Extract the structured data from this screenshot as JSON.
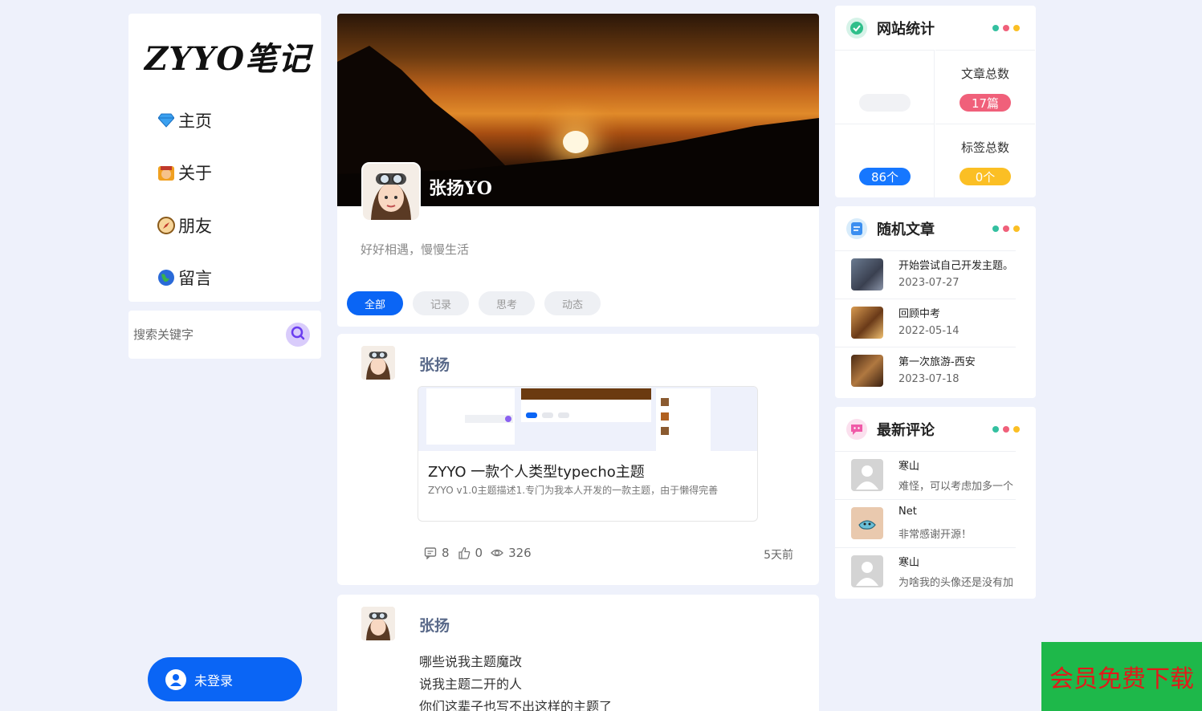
{
  "sidebar": {
    "logo": "ZYYO笔记",
    "nav": [
      {
        "label": "主页",
        "icon": "diamond-icon"
      },
      {
        "label": "关于",
        "icon": "king-icon"
      },
      {
        "label": "朋友",
        "icon": "compass-icon"
      },
      {
        "label": "留言",
        "icon": "globe-icon"
      }
    ],
    "search_placeholder": "搜索关键字",
    "login_label": "未登录"
  },
  "profile": {
    "name": "张扬YO",
    "bio": "好好相遇，慢慢生活",
    "tabs": [
      "全部",
      "记录",
      "思考",
      "动态"
    ],
    "active_tab": "全部"
  },
  "posts": [
    {
      "author": "张扬",
      "link_title": "ZYYO 一款个人类型typecho主题",
      "link_desc": "ZYYO v1.0主题描述1.专门为我本人开发的一款主题，由于懒得完善",
      "comments": "8",
      "likes": "0",
      "views": "326",
      "time": "5天前"
    },
    {
      "author": "张扬",
      "lines": [
        "哪些说我主题魔改",
        "说我主题二开的人",
        "你们这辈子也写不出这样的主题了"
      ]
    }
  ],
  "widgets": {
    "stats": {
      "title": "网站统计",
      "cells": [
        {
          "label": "",
          "value": "",
          "color": "#ffffff"
        },
        {
          "label": "文章总数",
          "value": "17篇",
          "color": "#f0607a"
        },
        {
          "label": "",
          "value": "86个",
          "color": "#1677ff"
        },
        {
          "label": "标签总数",
          "value": "0个",
          "color": "#fbbf24"
        }
      ]
    },
    "random": {
      "title": "随机文章",
      "items": [
        {
          "title": "开始尝试自己开发主题。",
          "date": "2023-07-27"
        },
        {
          "title": "回顾中考",
          "date": "2022-05-14"
        },
        {
          "title": "第一次旅游-西安",
          "date": "2023-07-18"
        }
      ]
    },
    "comments": {
      "title": "最新评论",
      "items": [
        {
          "name": "寒山",
          "text": "难怪，可以考虑加多一个"
        },
        {
          "name": "Net",
          "text": "非常感谢开源！"
        },
        {
          "name": "寒山",
          "text": "为啥我的头像还是没有加"
        }
      ]
    },
    "dot_colors": [
      "#34c0a0",
      "#f0607a",
      "#fbbf24"
    ]
  },
  "promo": {
    "label": "会员免费下载",
    "bg": "#1eb84a",
    "fg": "#e11a1a"
  }
}
